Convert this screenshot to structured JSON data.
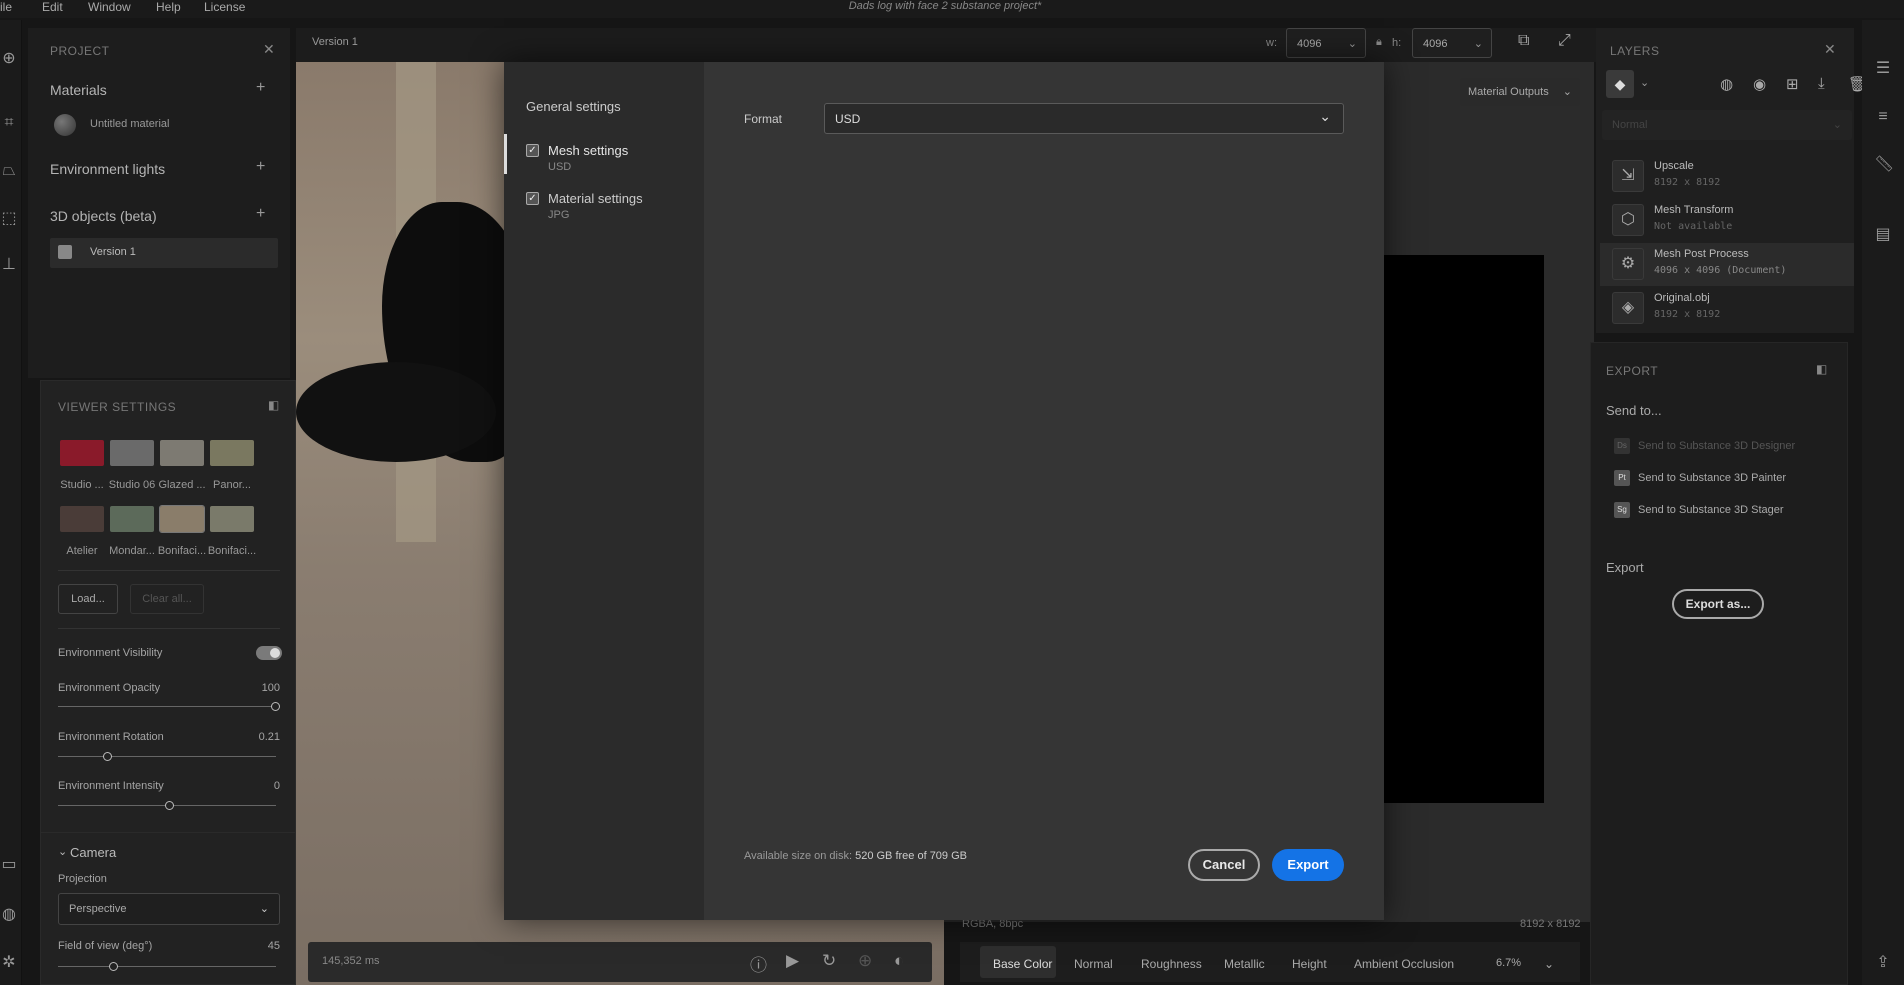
{
  "menubar": {
    "items": [
      "ile",
      "Edit",
      "Window",
      "Help",
      "License"
    ],
    "document_title": "Dads log with face 2 substance project*"
  },
  "project": {
    "header": "PROJECT",
    "materials_label": "Materials",
    "material_item": "Untitled material",
    "env_lights_label": "Environment lights",
    "objects_label": "3D objects (beta)",
    "object_item": "Version 1"
  },
  "viewer_settings": {
    "header": "VIEWER SETTINGS",
    "environments": [
      {
        "label": "Studio ...",
        "color": "#8a1a2a"
      },
      {
        "label": "Studio 06",
        "color": "#6a6a6a"
      },
      {
        "label": "Glazed ...",
        "color": "#7d7a72"
      },
      {
        "label": "Panor...",
        "color": "#7a7860"
      },
      {
        "label": "Atelier",
        "color": "#4a3c38"
      },
      {
        "label": "Mondar...",
        "color": "#5c6a5a"
      },
      {
        "label": "Bonifaci...",
        "color": "#8a7d6a"
      },
      {
        "label": "Bonifaci...",
        "color": "#7a7a6a"
      }
    ],
    "load_label": "Load...",
    "clear_label": "Clear all...",
    "env_visibility_label": "Environment Visibility",
    "env_opacity_label": "Environment Opacity",
    "env_opacity_value": "100",
    "env_rotation_label": "Environment Rotation",
    "env_rotation_value": "0.21",
    "env_intensity_label": "Environment Intensity",
    "env_intensity_value": "0",
    "camera_label": "Camera",
    "projection_label": "Projection",
    "projection_value": "Perspective",
    "fov_label": "Field of view (deg°)",
    "fov_value": "45"
  },
  "viewport": {
    "title": "Version 1",
    "render_time": "145,352 ms"
  },
  "size_controls": {
    "w_label": "w:",
    "w_value": "4096",
    "h_label": "h:",
    "h_value": "4096"
  },
  "material_outputs_label": "Material Outputs",
  "layers": {
    "header": "LAYERS",
    "blend_mode": "Normal",
    "items": [
      {
        "name": "Upscale",
        "sub": "8192 x 8192"
      },
      {
        "name": "Mesh Transform",
        "sub": "Not available"
      },
      {
        "name": "Mesh Post Process",
        "sub": "4096 x 4096 (Document)"
      },
      {
        "name": "Original.obj",
        "sub": "8192 x 8192"
      }
    ]
  },
  "export_panel": {
    "header": "EXPORT",
    "send_to_label": "Send to...",
    "send_items": [
      {
        "badge": "Ds",
        "label": "Send to Substance 3D Designer"
      },
      {
        "badge": "Pt",
        "label": "Send to Substance 3D Painter"
      },
      {
        "badge": "Sg",
        "label": "Send to Substance 3D Stager"
      }
    ],
    "export_label": "Export",
    "export_as_label": "Export as..."
  },
  "channel_bar": {
    "info_left": "RGBA, 8bpc",
    "info_right": "8192 x 8192",
    "tabs": [
      "Base Color",
      "Normal",
      "Roughness",
      "Metallic",
      "Height",
      "Ambient Occlusion"
    ],
    "zoom": "6.7%"
  },
  "modal": {
    "general_settings": "General settings",
    "mesh_settings": "Mesh settings",
    "mesh_sub": "USD",
    "material_settings": "Material settings",
    "material_sub": "JPG",
    "format_label": "Format",
    "format_value": "USD",
    "disk_prefix": "Available size on disk:",
    "disk_value": "520 GB free of 709 GB",
    "cancel_label": "Cancel",
    "export_label": "Export"
  }
}
